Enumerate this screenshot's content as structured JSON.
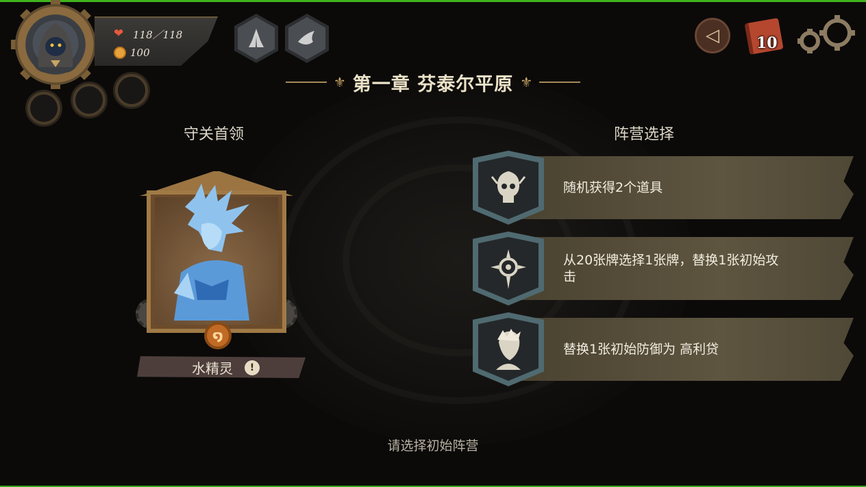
{
  "player": {
    "hp": "118／118",
    "gold": "100"
  },
  "chapter": {
    "title": "第一章 芬泰尔平原"
  },
  "boss_section": {
    "title": "守关首领",
    "boss_name": "水精灵",
    "emblem_symbol": "໑",
    "info_symbol": "!"
  },
  "faction_section": {
    "title": "阵营选择",
    "options": [
      {
        "text": "随机获得2个道具",
        "icon": "skull-crest-icon"
      },
      {
        "text": "从20张牌选择1张牌，替换1张初始攻击",
        "icon": "sun-crest-icon"
      },
      {
        "text": "替换1张初始防御为 高利贷",
        "icon": "rogue-face-icon"
      }
    ]
  },
  "deck": {
    "count": "10"
  },
  "back_symbol": "◁",
  "prompt": "请选择初始阵营",
  "colors": {
    "accent_gold": "#c9a564",
    "banner": "#5e5540",
    "shield": "#4f6a70",
    "top_line": "#3fb31c"
  }
}
